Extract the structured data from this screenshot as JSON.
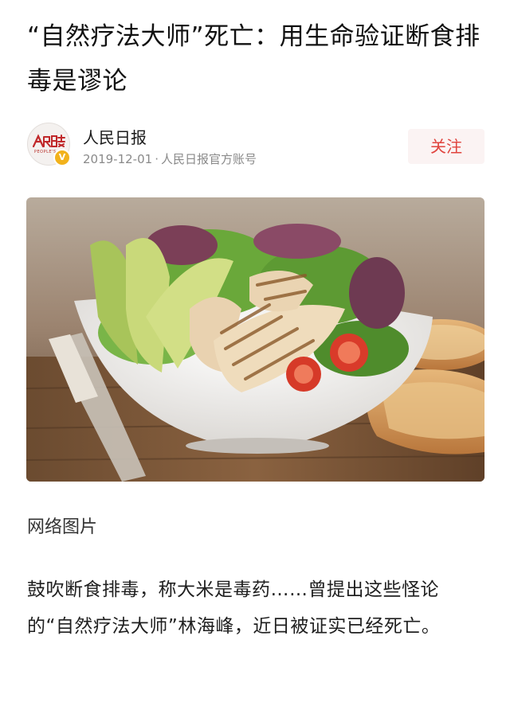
{
  "article": {
    "title": "“自然疗法大师”死亡：用生命验证断食排毒是谬论",
    "author": {
      "name": "人民日报",
      "date": "2019-12-01",
      "separator": "·",
      "source": "人民日报官方账号",
      "avatar_icon": "peoples-daily-logo",
      "avatar_text": "PEOPLE'S",
      "verified_icon": "verified-badge-icon",
      "verified_glyph": "V"
    },
    "follow_label": "关注",
    "image": {
      "icon": "salad-bowl-photo"
    },
    "caption": "网络图片",
    "paragraph": "鼓吹断食排毒，称大米是毒药……曾提出这些怪论的“自然疗法大师”林海峰，近日被证实已经死亡。"
  },
  "colors": {
    "accent": "#e0443e",
    "follow_bg": "#fbf3f3",
    "meta_gray": "#8a8a8a",
    "verified": "#f2b21c"
  }
}
